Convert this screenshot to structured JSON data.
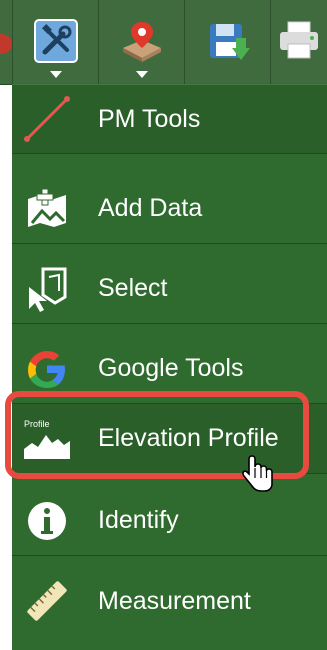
{
  "toolbar": {
    "buttons": [
      {
        "icon": "tools-icon",
        "has_dropdown": true
      },
      {
        "icon": "map-marker-icon",
        "has_dropdown": true
      },
      {
        "icon": "save-icon",
        "has_dropdown": false
      },
      {
        "icon": "print-icon",
        "has_dropdown": false
      }
    ]
  },
  "menu": {
    "items": [
      {
        "label": "PM Tools",
        "icon": "pm-line-icon"
      },
      {
        "label": "Add Data",
        "icon": "add-data-icon"
      },
      {
        "label": "Select",
        "icon": "select-icon"
      },
      {
        "label": "Google Tools",
        "icon": "google-icon"
      },
      {
        "label": "Elevation Profile",
        "icon": "elevation-profile-icon",
        "icon_text": "Profile",
        "highlighted": true
      },
      {
        "label": "Identify",
        "icon": "info-icon"
      },
      {
        "label": "Measurement",
        "icon": "ruler-icon"
      }
    ]
  },
  "colors": {
    "toolbar_bg": "#3f6b3f",
    "menu_bg": "#2f6a2f",
    "highlight_ring": "#e94a3f",
    "text": "#ffffff"
  }
}
